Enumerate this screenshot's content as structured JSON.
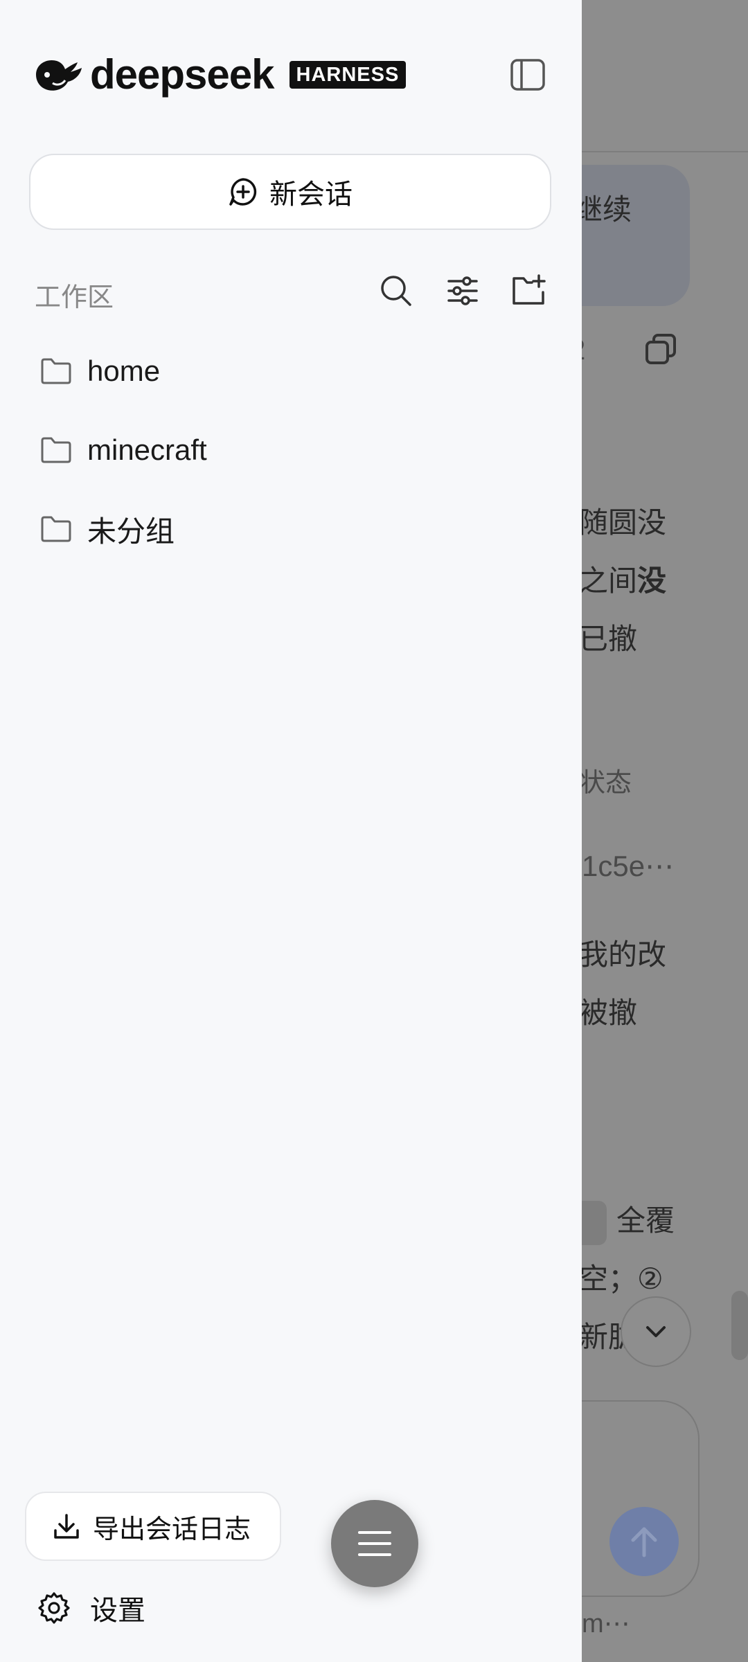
{
  "drawer": {
    "brand": "deepseek",
    "badge": "HARNESS",
    "new_chat_label": "新会话",
    "workspace_title": "工作区",
    "folders": [
      {
        "label": "home"
      },
      {
        "label": "minecraft"
      },
      {
        "label": "未分组"
      }
    ],
    "export_label": "导出会话日志",
    "settings_label": "设置"
  },
  "background": {
    "bubble_text": "继续",
    "line1": "随圆没",
    "line2a": "之间",
    "line2b": "没",
    "line3": "已撤",
    "line4": "状态",
    "line5": "(1c5e⋯",
    "line6": "我的改",
    "line7": "被撤",
    "line8": "全覆",
    "line9": "空；②",
    "line10": "新肱",
    "line11": "m⋯",
    "partial": "2"
  },
  "colors": {
    "drawer_bg": "#f7f8fa",
    "overlay": "#8d8d8d",
    "send_button": "#6f7fa8"
  }
}
